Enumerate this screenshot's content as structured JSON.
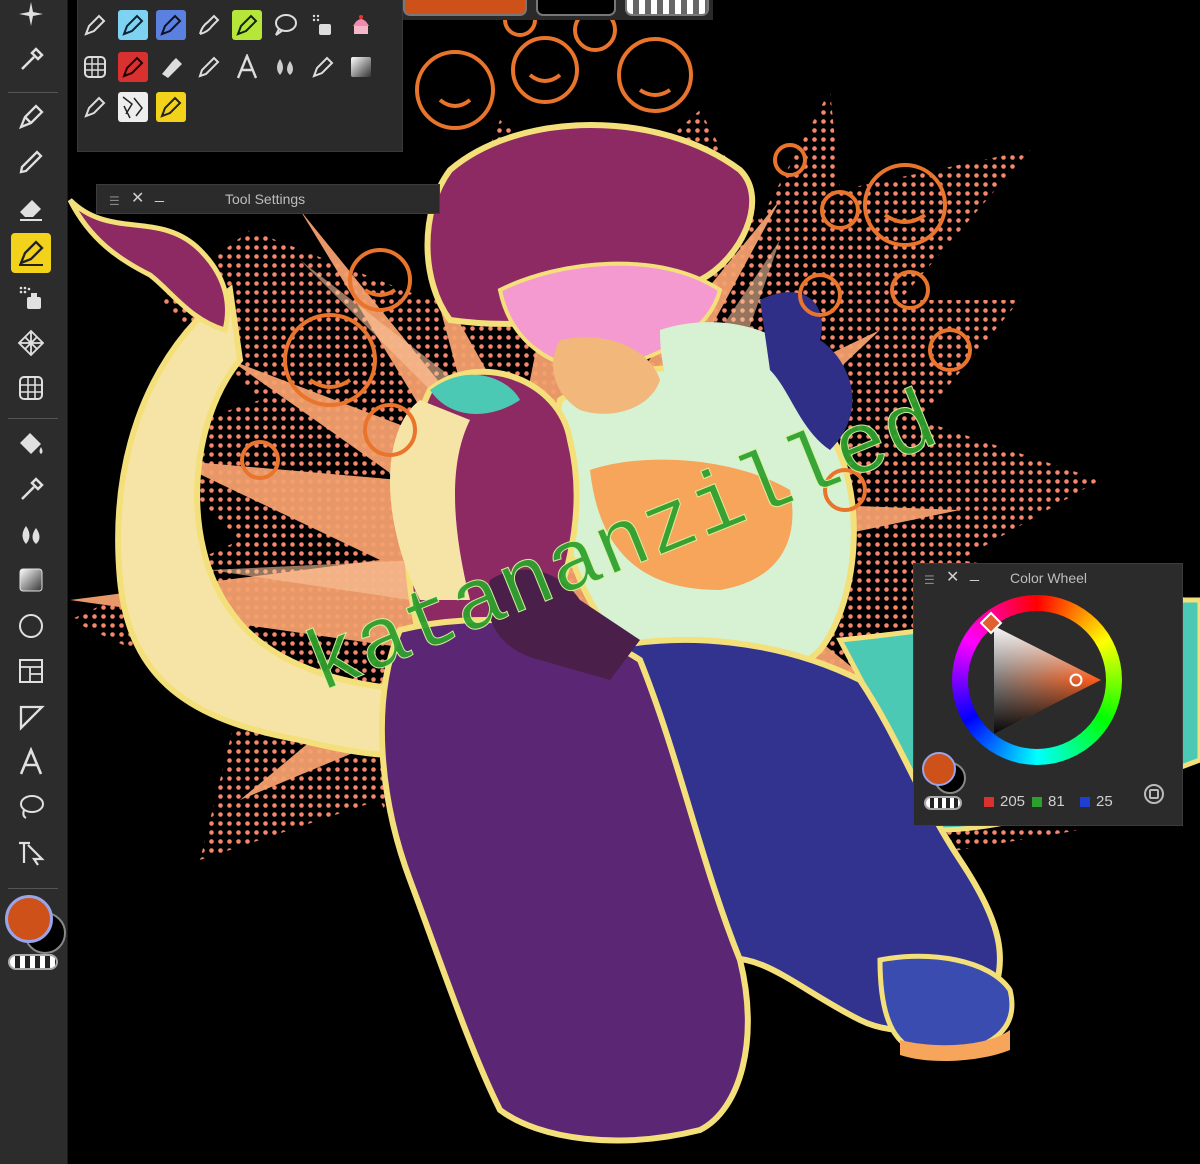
{
  "artwork": {
    "watermark": "katananzilled",
    "background_color": "#000000",
    "accent_colors": {
      "outline_yellow": "#f4e07a",
      "sunburst_orange": "#f4a06e",
      "halftone_salmon": "#f7876a",
      "shirt_magenta": "#8d2a63",
      "pants_purple": "#5b2673",
      "pants_blue": "#31338f",
      "skin_mint": "#d6f2d2",
      "tail_cream": "#f6e4a7",
      "emoji_orange": "#e9742c",
      "watermark_green": "#2fa12f"
    }
  },
  "left_toolbar": {
    "tools": [
      {
        "name": "sparkle-icon"
      },
      {
        "name": "eyedropper-icon"
      },
      {
        "name": "pen-icon"
      },
      {
        "name": "pencil-icon"
      },
      {
        "name": "eraser-icon"
      },
      {
        "name": "brush-icon",
        "active": true
      },
      {
        "name": "spray-icon"
      },
      {
        "name": "pattern-icon"
      },
      {
        "name": "grid-transform-icon"
      },
      {
        "name": "fill-icon"
      },
      {
        "name": "eyedropper-2-icon"
      },
      {
        "name": "blend-icon"
      },
      {
        "name": "gradient-icon"
      },
      {
        "name": "ellipse-icon"
      },
      {
        "name": "panel-layout-icon"
      },
      {
        "name": "crop-icon"
      },
      {
        "name": "text-icon"
      },
      {
        "name": "lasso-icon"
      },
      {
        "name": "select-arrow-icon"
      }
    ],
    "primary_color": "#cd5119",
    "secondary_color": "#000000"
  },
  "brush_palette": {
    "rows": [
      [
        "fountain-pen",
        "blue-pen",
        "blue-pen-2",
        "marker",
        "green-pen",
        "speech-bubble",
        "airbrush",
        "cake-brush"
      ],
      [
        "grid-brush",
        "red-pen",
        "flat-marker",
        "pencil-brush",
        "text-brush",
        "drops-brush",
        "pen-nib",
        "gradient-square"
      ],
      [
        "ink-pen",
        "manga-tone",
        "yellow-pen"
      ]
    ]
  },
  "tool_settings": {
    "title": "Tool Settings"
  },
  "color_wheel": {
    "title": "Color Wheel",
    "red": "205",
    "green": "81",
    "blue": "25",
    "current_color": "#cd5119"
  }
}
